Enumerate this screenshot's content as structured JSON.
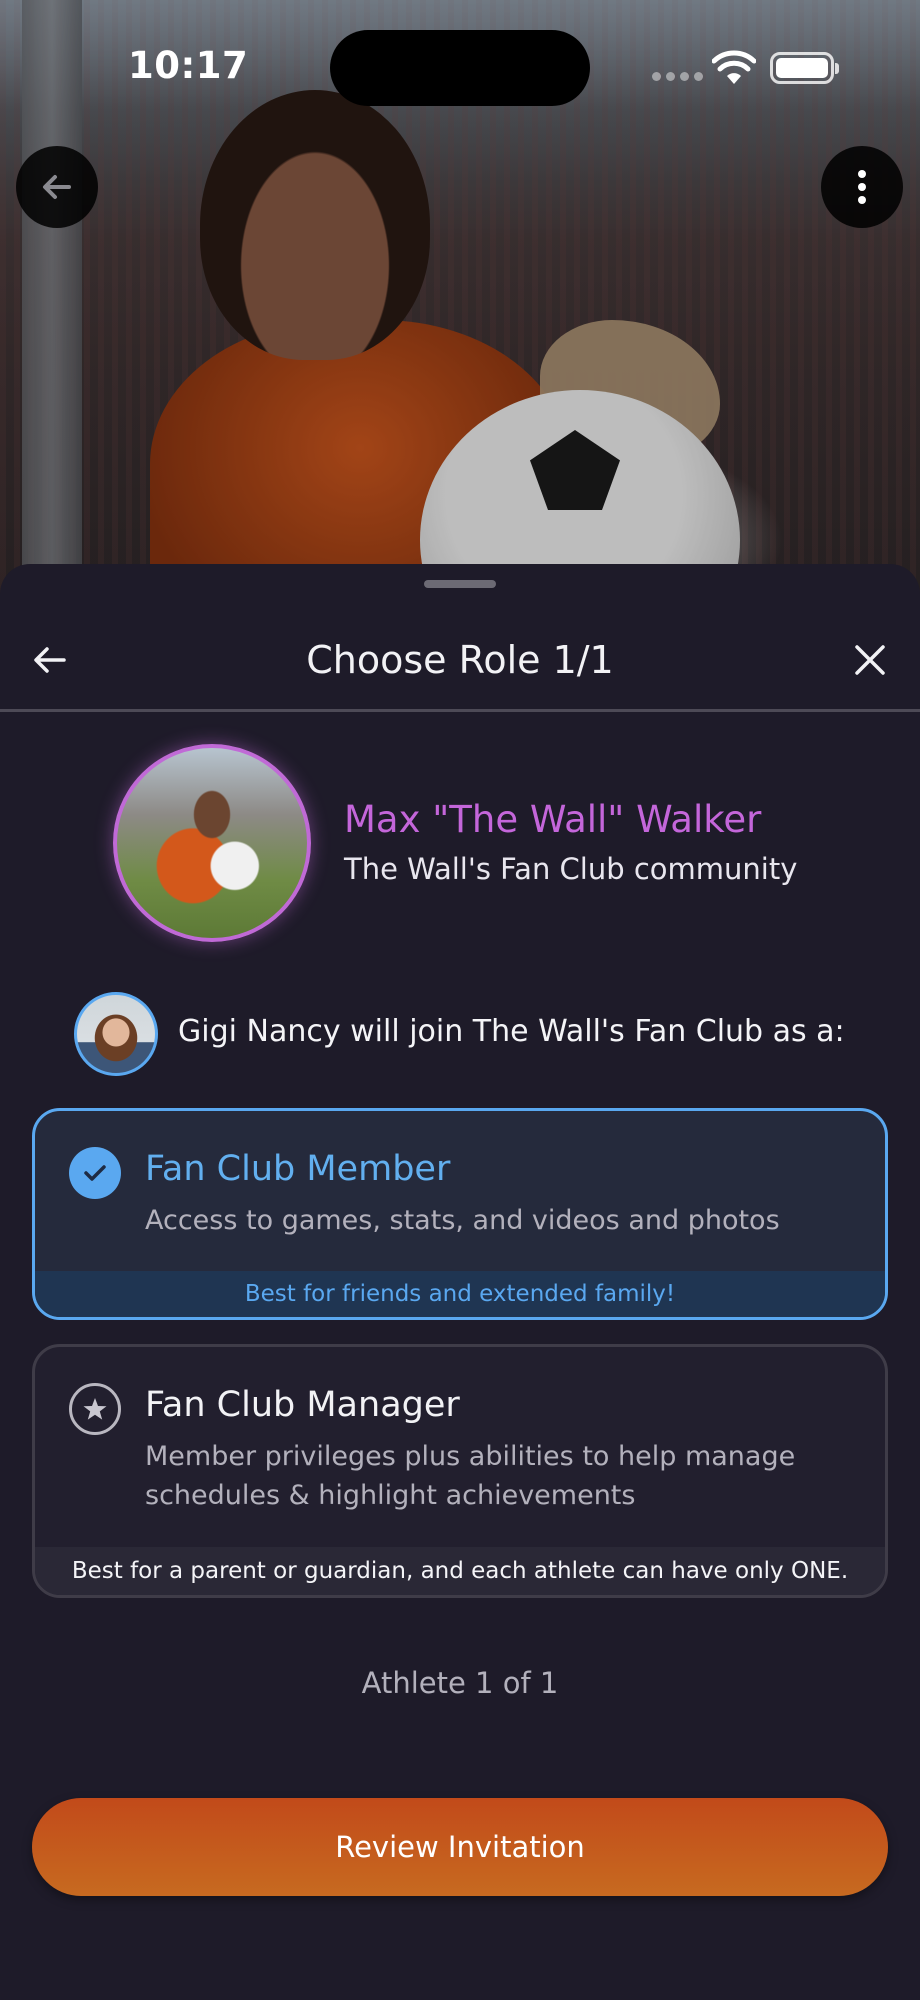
{
  "status_bar": {
    "time": "10:17"
  },
  "hero": {
    "back_icon": "arrow-left-icon",
    "more_icon": "more-vertical-icon"
  },
  "sheet": {
    "title": "Choose Role 1/1",
    "back_icon": "arrow-left-icon",
    "close_icon": "close-icon"
  },
  "athlete": {
    "name": "Max \"The Wall\" Walker",
    "community": "The Wall's Fan Club community"
  },
  "invitee": {
    "text": "Gigi Nancy will join The Wall's Fan Club as a:"
  },
  "roles": [
    {
      "title": "Fan Club Member",
      "description": "Access to games, stats, and videos and photos",
      "footer": "Best for friends and extended family!",
      "selected": true,
      "icon": "check-circle-icon"
    },
    {
      "title": "Fan Club Manager",
      "description": "Member privileges plus abilities to help manage schedules & highlight achievements",
      "footer": "Best for a parent or guardian, and each athlete can have only ONE.",
      "selected": false,
      "icon": "star-circle-icon"
    }
  ],
  "progress": "Athlete 1 of 1",
  "primary_button": "Review Invitation",
  "colors": {
    "accent_blue": "#5aa8f0",
    "accent_purple": "#c466da",
    "button_orange": "#c24a1a",
    "background": "#1e1b29"
  }
}
